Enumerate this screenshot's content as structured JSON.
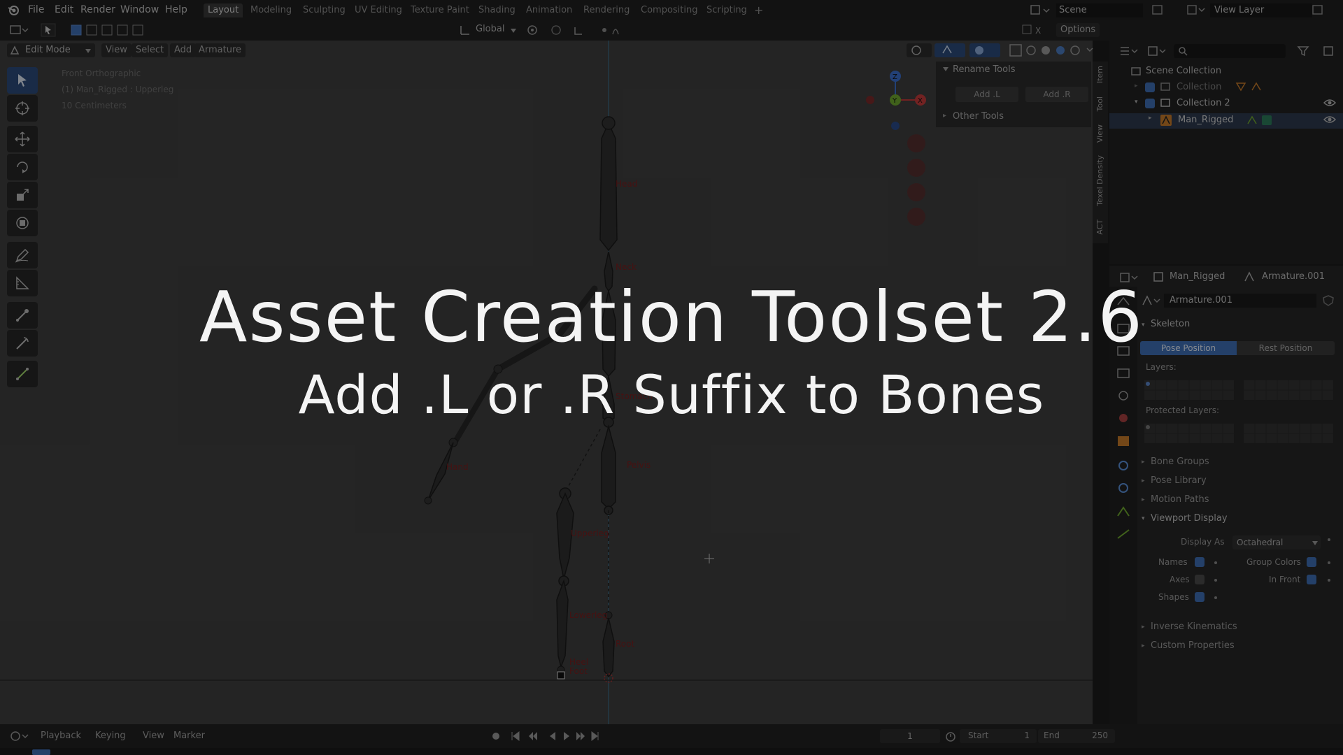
{
  "menu": {
    "items": [
      "File",
      "Edit",
      "Render",
      "Window",
      "Help"
    ]
  },
  "workspaces": [
    {
      "label": "Layout",
      "active": true
    },
    {
      "label": "Modeling",
      "active": false
    },
    {
      "label": "Sculpting",
      "active": false
    },
    {
      "label": "UV Editing",
      "active": false
    },
    {
      "label": "Texture Paint",
      "active": false
    },
    {
      "label": "Shading",
      "active": false
    },
    {
      "label": "Animation",
      "active": false
    },
    {
      "label": "Rendering",
      "active": false
    },
    {
      "label": "Compositing",
      "active": false
    },
    {
      "label": "Scripting",
      "active": false
    }
  ],
  "add_workspace": "+",
  "scene": "Scene",
  "view_layer": "View Layer",
  "header": {
    "transform_orientation": "Global",
    "options": "Options"
  },
  "viewport_header": {
    "mode": "Edit Mode",
    "view": "View",
    "select": "Select",
    "add": "Add",
    "armature": "Armature"
  },
  "viewport_info": {
    "line1": "Front Orthographic",
    "line2": "(1) Man_Rigged : Upperleg",
    "line3": "10 Centimeters"
  },
  "gizmo": {
    "z": "Z",
    "y": "Y",
    "x": "X"
  },
  "rename_tools": {
    "title": "Rename Tools",
    "add_l": "Add .L",
    "add_r": "Add .R",
    "other_tools": "Other Tools"
  },
  "side_tabs": [
    "Item",
    "Tool",
    "View",
    "Texel Density",
    "ACT"
  ],
  "bones": [
    "Head",
    "Neck",
    "Stomach",
    "Pelvis",
    "Hand",
    "Upperleg",
    "Lowerleg",
    "Root",
    "Heel",
    "Foot"
  ],
  "outliner": {
    "scene_collection": "Scene Collection",
    "collection": "Collection",
    "collection2": "Collection 2",
    "object": "Man_Rigged"
  },
  "properties": {
    "object": "Man_Rigged",
    "data": "Armature.001",
    "data_field": "Armature.001",
    "skeleton": "Skeleton",
    "pose_position": "Pose Position",
    "rest_position": "Rest Position",
    "layers": "Layers:",
    "protected_layers": "Protected Layers:",
    "bone_groups": "Bone Groups",
    "pose_library": "Pose Library",
    "motion_paths": "Motion Paths",
    "viewport_display": "Viewport Display",
    "display_as_label": "Display As",
    "display_as_value": "Octahedral",
    "names": "Names",
    "axes": "Axes",
    "shapes": "Shapes",
    "group_colors": "Group Colors",
    "in_front": "In Front",
    "inverse_kinematics": "Inverse Kinematics",
    "custom_properties": "Custom Properties",
    "names_checked": true,
    "axes_checked": false,
    "shapes_checked": true,
    "group_colors_checked": true,
    "in_front_checked": true
  },
  "timeline": {
    "playback": "Playback",
    "keying": "Keying",
    "view": "View",
    "marker": "Marker",
    "current_frame": "1",
    "start_label": "Start",
    "start_value": "1",
    "end_label": "End",
    "end_value": "250"
  },
  "overlay": {
    "title": "Asset Creation Toolset 2.6",
    "subtitle": "Add .L or .R Suffix to Bones"
  },
  "colors": {
    "accent": "#3e6eb5",
    "bone_label": "#7a1e1e",
    "gizmo_x": "#c43c3c",
    "gizmo_y": "#6fa830",
    "gizmo_z": "#3b6ecb"
  }
}
